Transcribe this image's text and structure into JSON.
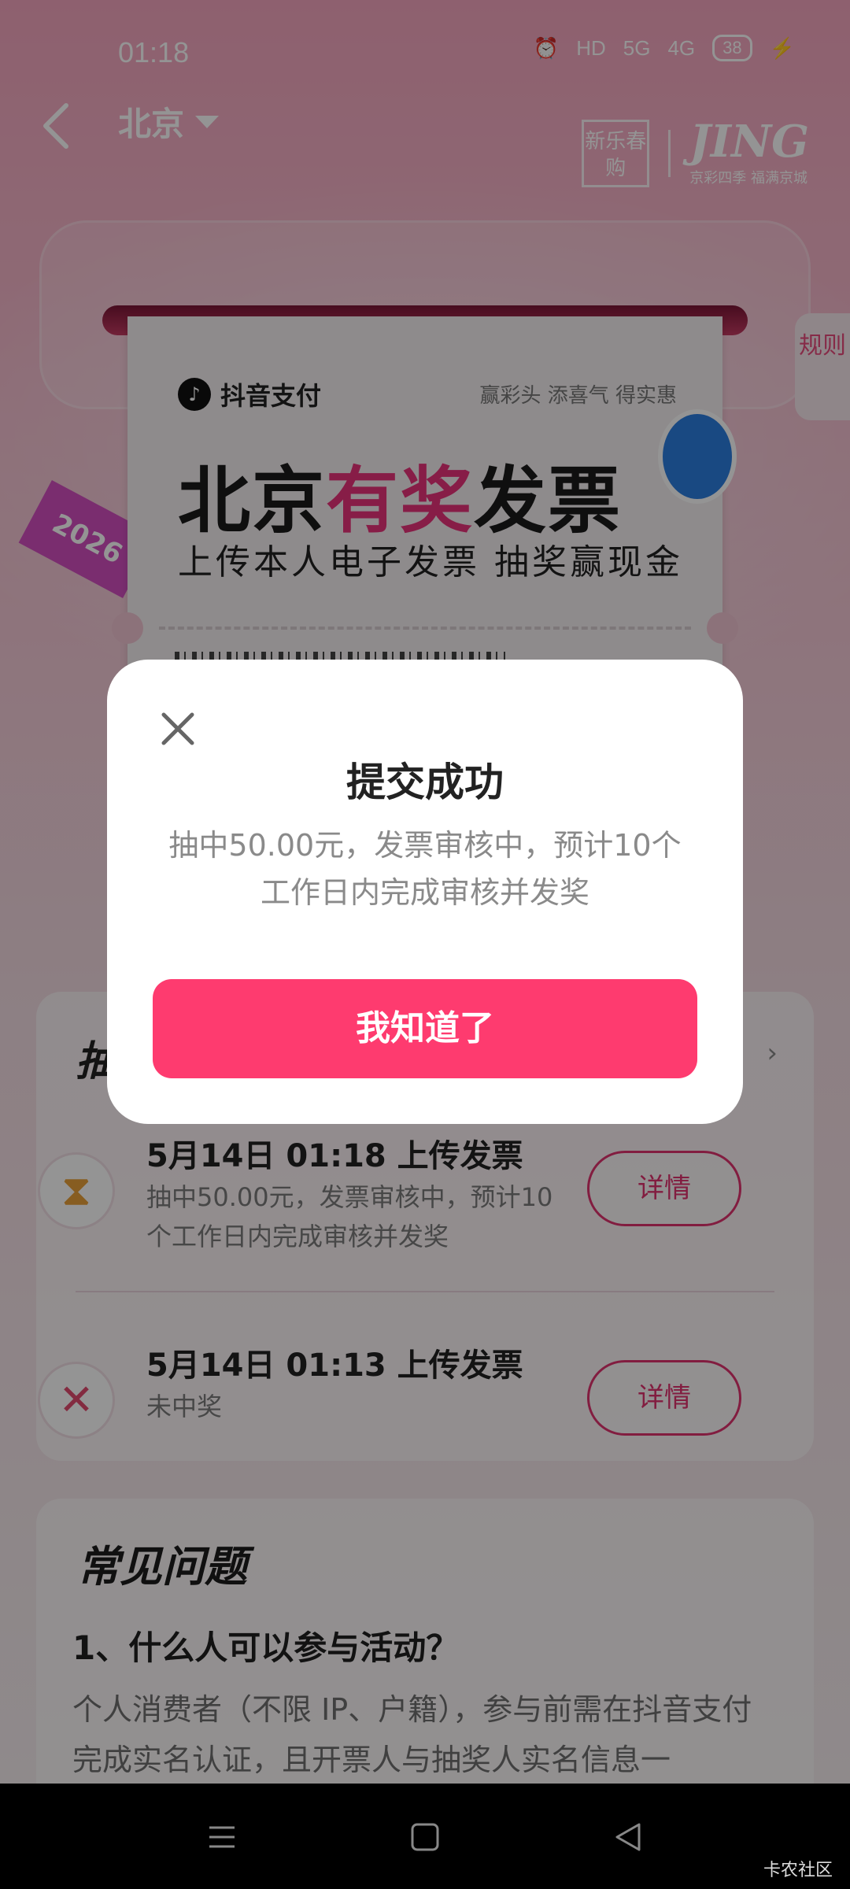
{
  "status_bar": {
    "time": "01:18",
    "network_1": "HD",
    "network_2": "5G",
    "network_3": "4G",
    "battery": "38"
  },
  "nav": {
    "city": "北京",
    "logo_stamp": "新乐春购",
    "logo_brand": "JING",
    "logo_sub": "京彩四季 福满京城"
  },
  "side_tab": {
    "rules": "规则"
  },
  "ticket": {
    "pay_brand": "抖音支付",
    "slogan": "赢彩头 添喜气 得实惠",
    "headline_a": "北京",
    "headline_b": "有奖",
    "headline_c": "发票",
    "subline": "上传本人电子发票 抽奖赢现金",
    "year": "2026"
  },
  "records": {
    "title": "抽",
    "items": [
      {
        "title": "5月14日 01:18 上传发票",
        "desc": "抽中50.00元，发票审核中，预计10个工作日内完成审核并发奖",
        "button": "详情",
        "status_icon": "hourglass-icon"
      },
      {
        "title": "5月14日 01:13 上传发票",
        "desc": "未中奖",
        "button": "详情",
        "status_icon": "cross-icon"
      }
    ]
  },
  "faq": {
    "title": "常见问题",
    "question": "1、什么人可以参与活动？",
    "answer": "个人消费者（不限 IP、户籍），参与前需在抖音支付完成实名认证，且开票人与抽奖人实名信息一"
  },
  "modal": {
    "title": "提交成功",
    "desc": "抽中50.00元，发票审核中，预计10个工作日内完成审核并发奖",
    "ok_button": "我知道了"
  },
  "watermark": "卡农社区",
  "colors": {
    "accent": "#fe3b6f",
    "detail_border": "#e0336e",
    "headline_highlight": "#e8337a"
  }
}
